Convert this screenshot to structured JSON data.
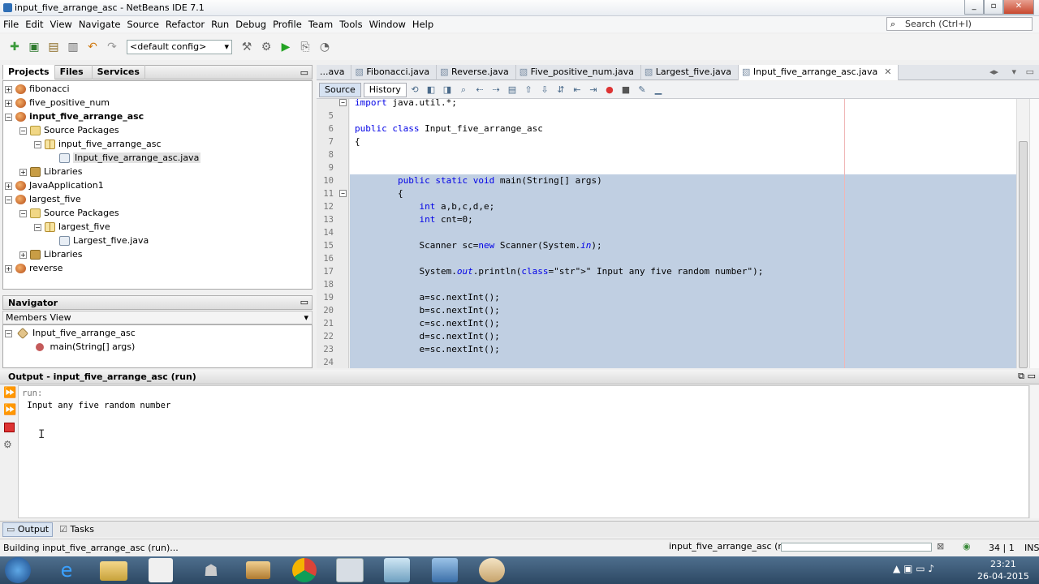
{
  "window": {
    "title": "input_five_arrange_asc - NetBeans IDE 7.1"
  },
  "menu": [
    "File",
    "Edit",
    "View",
    "Navigate",
    "Source",
    "Refactor",
    "Run",
    "Debug",
    "Profile",
    "Team",
    "Tools",
    "Window",
    "Help"
  ],
  "search": {
    "placeholder": "Search (Ctrl+I)"
  },
  "toolbar": {
    "config": "<default config>"
  },
  "projects_panel": {
    "tabs": [
      "Projects",
      "Files",
      "Services"
    ],
    "tree": [
      {
        "label": "fibonacci",
        "type": "project",
        "level": 0,
        "expanded": false
      },
      {
        "label": "five_positive_num",
        "type": "project",
        "level": 0,
        "expanded": false
      },
      {
        "label": "input_five_arrange_asc",
        "type": "project",
        "level": 0,
        "expanded": true,
        "bold": true
      },
      {
        "label": "Source Packages",
        "type": "folder",
        "level": 1,
        "expanded": true
      },
      {
        "label": "input_five_arrange_asc",
        "type": "package",
        "level": 2,
        "expanded": true
      },
      {
        "label": "Input_five_arrange_asc.java",
        "type": "java",
        "level": 3,
        "selected": true
      },
      {
        "label": "Libraries",
        "type": "lib",
        "level": 1,
        "expanded": false
      },
      {
        "label": "JavaApplication1",
        "type": "project",
        "level": 0,
        "expanded": false
      },
      {
        "label": "largest_five",
        "type": "project",
        "level": 0,
        "expanded": true
      },
      {
        "label": "Source Packages",
        "type": "folder",
        "level": 1,
        "expanded": true
      },
      {
        "label": "largest_five",
        "type": "package",
        "level": 2,
        "expanded": true
      },
      {
        "label": "Largest_five.java",
        "type": "java",
        "level": 3
      },
      {
        "label": "Libraries",
        "type": "lib",
        "level": 1,
        "expanded": false
      },
      {
        "label": "reverse",
        "type": "project",
        "level": 0,
        "expanded": false
      }
    ]
  },
  "navigator": {
    "title": "Navigator",
    "view": "Members View",
    "class_name": "Input_five_arrange_asc",
    "method": "main(String[] args)"
  },
  "editor": {
    "tabs": [
      "...ava",
      "Fibonacci.java",
      "Reverse.java",
      "Five_positive_num.java",
      "Largest_five.java",
      "Input_five_arrange_asc.java"
    ],
    "active_tab": "Input_five_arrange_asc.java",
    "source_tab": "Source",
    "history_tab": "History",
    "lines": [
      {
        "n": "",
        "text": "import java.util.*;",
        "hl": false
      },
      {
        "n": "5",
        "text": "",
        "hl": false
      },
      {
        "n": "6",
        "text": "public class Input_five_arrange_asc",
        "hl": false
      },
      {
        "n": "7",
        "text": "{",
        "hl": false
      },
      {
        "n": "8",
        "text": "",
        "hl": false
      },
      {
        "n": "9",
        "text": "",
        "hl": false
      },
      {
        "n": "10",
        "text": "        public static void main(String[] args)",
        "hl": true
      },
      {
        "n": "11",
        "text": "        {",
        "hl": true
      },
      {
        "n": "12",
        "text": "            int a,b,c,d,e;",
        "hl": true
      },
      {
        "n": "13",
        "text": "            int cnt=0;",
        "hl": true
      },
      {
        "n": "14",
        "text": "",
        "hl": true
      },
      {
        "n": "15",
        "text": "            Scanner sc=new Scanner(System.in);",
        "hl": true
      },
      {
        "n": "16",
        "text": "",
        "hl": true
      },
      {
        "n": "17",
        "text": "            System.out.println(\" Input any five random number\");",
        "hl": true
      },
      {
        "n": "18",
        "text": "",
        "hl": true
      },
      {
        "n": "19",
        "text": "            a=sc.nextInt();",
        "hl": true
      },
      {
        "n": "20",
        "text": "            b=sc.nextInt();",
        "hl": true
      },
      {
        "n": "21",
        "text": "            c=sc.nextInt();",
        "hl": true
      },
      {
        "n": "22",
        "text": "            d=sc.nextInt();",
        "hl": true
      },
      {
        "n": "23",
        "text": "            e=sc.nextInt();",
        "hl": true
      },
      {
        "n": "24",
        "text": "",
        "hl": true
      }
    ]
  },
  "output": {
    "title": "Output - input_five_arrange_asc (run)",
    "lines": [
      "run:",
      " Input any five random number"
    ]
  },
  "bottom_tabs": [
    "Output",
    "Tasks"
  ],
  "status": {
    "left": "Building input_five_arrange_asc (run)...",
    "task": "input_five_arrange_asc (run)",
    "position": "34 | 1",
    "mode": "INS"
  },
  "taskbar": {
    "time": "23:21",
    "date": "26-04-2015"
  }
}
